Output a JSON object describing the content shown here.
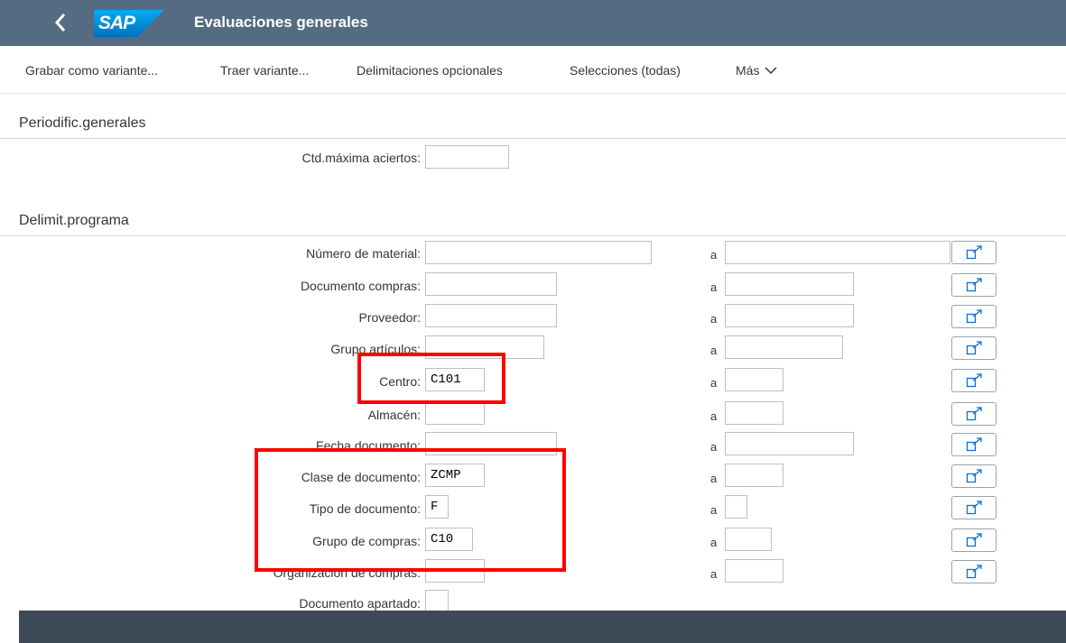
{
  "shell": {
    "back_icon": "chevron-left-icon",
    "logo_text": "SAP",
    "title": "Evaluaciones generales"
  },
  "toolbar": {
    "save_variant": "Grabar como variante...",
    "get_variant": "Traer variante...",
    "optional_delimitations": "Delimitaciones opcionales",
    "selections_all": "Selecciones (todas)",
    "more": "Más"
  },
  "sections": {
    "general": "Periodific.generales",
    "program": "Delimit.programa"
  },
  "general": {
    "max_hits_label": "Ctd.máxima aciertos:",
    "max_hits_value": ""
  },
  "range_separator": "a",
  "fields": [
    {
      "label": "Número de material:",
      "low": "",
      "high": ""
    },
    {
      "label": "Documento compras:",
      "low": "",
      "high": ""
    },
    {
      "label": "Proveedor:",
      "low": "",
      "high": ""
    },
    {
      "label": "Grupo artículos:",
      "low": "",
      "high": ""
    },
    {
      "label": "Centro:",
      "low": "C101",
      "high": ""
    },
    {
      "label": "Almacén:",
      "low": "",
      "high": ""
    },
    {
      "label": "Fecha documento:",
      "low": "",
      "high": ""
    },
    {
      "label": "Clase de documento:",
      "low": "ZCMP",
      "high": ""
    },
    {
      "label": "Tipo de documento:",
      "low": "F",
      "high": ""
    },
    {
      "label": "Grupo de compras:",
      "low": "C10",
      "high": ""
    },
    {
      "label": "Organización de compras:",
      "low": "",
      "high": ""
    },
    {
      "label": "Documento apartado:",
      "low": ""
    }
  ],
  "colors": {
    "shell": "#556b82",
    "highlight": "#ff0000",
    "footer": "#3d4a57"
  }
}
